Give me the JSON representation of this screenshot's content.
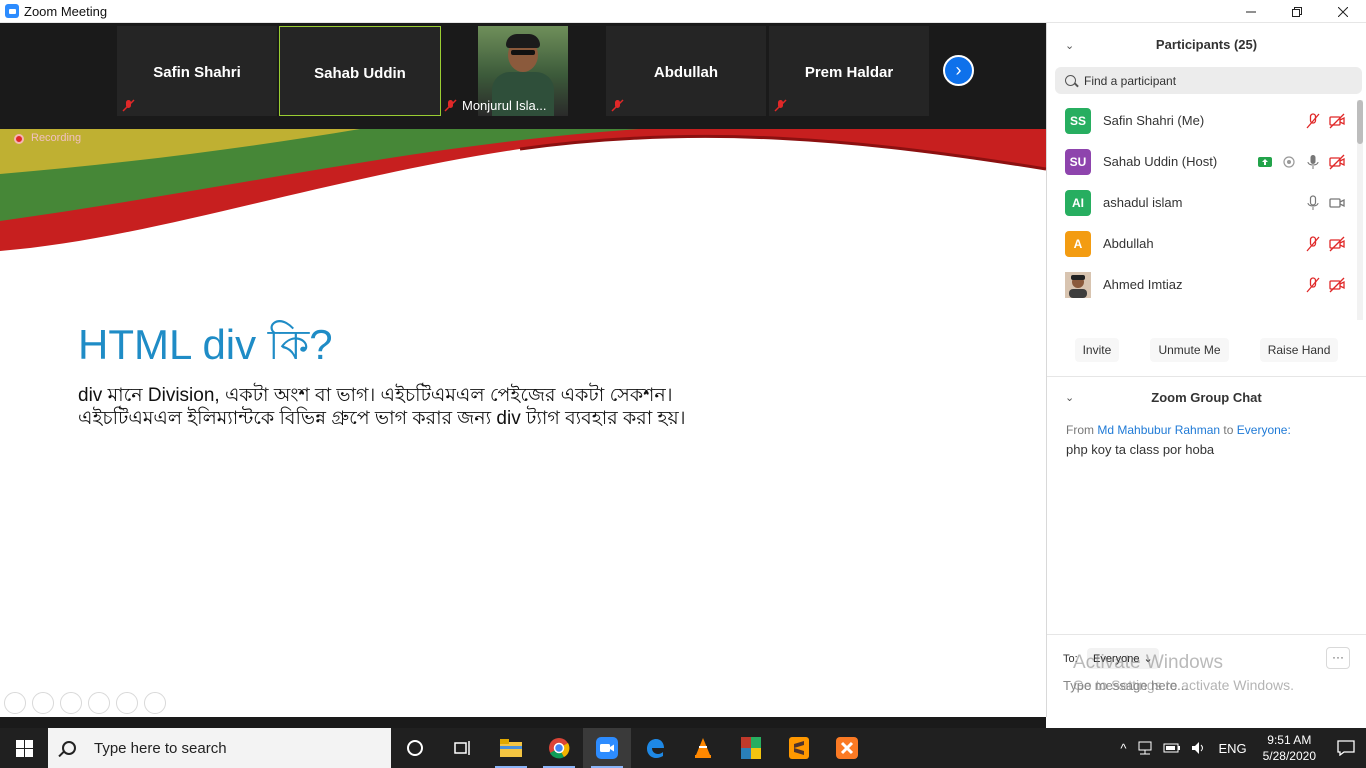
{
  "window": {
    "title": "Zoom Meeting"
  },
  "gallery": {
    "tiles": [
      {
        "name": "Safin Shahri"
      },
      {
        "name": "Sahab Uddin"
      },
      {
        "name": "Abdullah"
      },
      {
        "name": "Prem Haldar"
      }
    ],
    "photo_tile_name": "Monjurul Isla..."
  },
  "share": {
    "recording_label": "Recording",
    "slide_title": "HTML div কি?",
    "slide_line1": "div মানে Division, একটা অংশ বা ভাগ। এইচটিএমএল পেইজের একটা সেকশন।",
    "slide_line2": "এইচটিএমএল ইলিম্যান্টকে বিভিন্ন গ্রুপে ভাগ করার জন্য div ট্যাগ ব্যবহার করা হয়।"
  },
  "participants": {
    "title": "Participants (25)",
    "search_placeholder": "Find a participant",
    "list": [
      {
        "initials": "SS",
        "name": "Safin Shahri (Me)",
        "color": "#27ae60"
      },
      {
        "initials": "SU",
        "name": "Sahab Uddin (Host)",
        "color": "#8e44ad"
      },
      {
        "initials": "AI",
        "name": "ashadul islam",
        "color": "#27ae60"
      },
      {
        "initials": "A",
        "name": "Abdullah",
        "color": "#f39c12"
      },
      {
        "initials": "",
        "name": "Ahmed Imtiaz",
        "color": "#7a5230"
      }
    ],
    "buttons": {
      "invite": "Invite",
      "unmute": "Unmute Me",
      "raise_hand": "Raise Hand"
    }
  },
  "chat": {
    "title": "Zoom Group Chat",
    "from_prefix": "From",
    "from_name": "Md Mahbubur Rahman",
    "to_word": "to",
    "to_target": "Everyone:",
    "message": "php koy ta class por hoba",
    "to_label": "To:",
    "to_value": "Everyone",
    "more": "···",
    "input_placeholder": "Type message here..."
  },
  "watermark": {
    "line1": "Activate Windows",
    "line2": "Go to Settings to activate Windows."
  },
  "taskbar": {
    "search_placeholder": "Type here to search",
    "language": "ENG",
    "time": "9:51 AM",
    "date": "5/28/2020"
  },
  "colors": {
    "zoom_blue": "#2d8cff",
    "accent_green": "#9acd32",
    "mute_red": "#e02828"
  }
}
